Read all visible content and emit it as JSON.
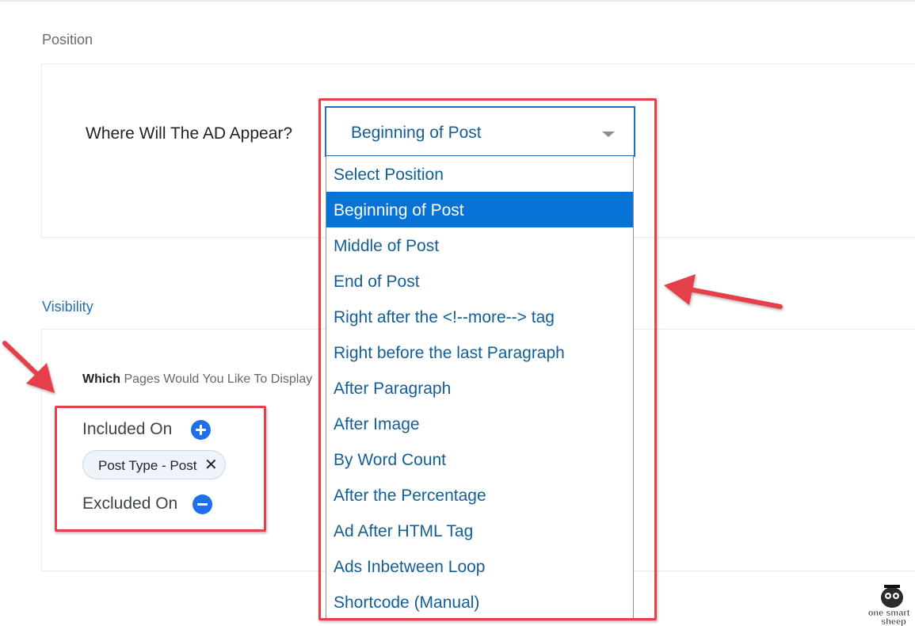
{
  "position_section": {
    "title": "Position",
    "question": "Where Will The AD Appear?",
    "select": {
      "value": "Beginning of Post",
      "options": [
        "Select Position",
        "Beginning of Post",
        "Middle of Post",
        "End of Post",
        "Right after the <!--more--> tag",
        "Right before the last Paragraph",
        "After Paragraph",
        "After Image",
        "By Word Count",
        "After the Percentage",
        "Ad After HTML Tag",
        "Ads Inbetween Loop",
        "Shortcode (Manual)"
      ],
      "selected_index": 1
    }
  },
  "visibility_section": {
    "title": "Visibility",
    "which_bold": "Which",
    "which_rest": " Pages Would You Like To Display",
    "included_label": "Included On",
    "included_chip": "Post Type - Post",
    "chip_remove": "✕",
    "excluded_label": "Excluded On"
  },
  "logo": {
    "line1": "one smart",
    "line2": "sheep"
  },
  "colors": {
    "accent": "#2271b1",
    "selected_option": "#0873d6",
    "annotation_red": "#e5414a",
    "add_button": "#1e6fe8"
  }
}
